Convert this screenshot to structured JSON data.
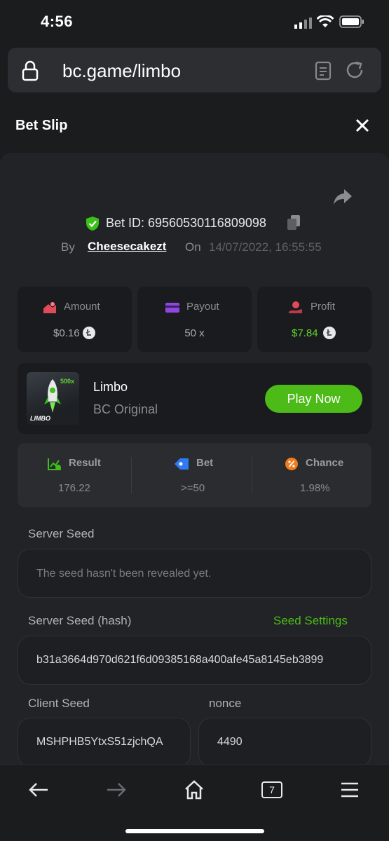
{
  "status_bar": {
    "time": "4:56"
  },
  "browser": {
    "url": "bc.game/limbo",
    "tab_count": "7"
  },
  "header": {
    "title": "Bet Slip"
  },
  "bet": {
    "id_label": "Bet ID: 69560530116809098",
    "by_label": "By",
    "user": "Cheesecakezt",
    "on_label": "On",
    "datetime": "14/07/2022, 16:55:55"
  },
  "stats": {
    "amount_label": "Amount",
    "amount_value": "$0.16",
    "payout_label": "Payout",
    "payout_value": "50 x",
    "profit_label": "Profit",
    "profit_value": "$7.84"
  },
  "game": {
    "thumb_badge": "500x",
    "thumb_logo": "LIMBO",
    "name": "Limbo",
    "provider": "BC Original",
    "play_label": "Play Now"
  },
  "result": {
    "result_label": "Result",
    "result_value": "176.22",
    "bet_label": "Bet",
    "bet_value": ">=50",
    "chance_label": "Chance",
    "chance_value": "1.98%"
  },
  "seeds": {
    "server_seed_label": "Server Seed",
    "server_seed_value": "The seed hasn't been revealed yet.",
    "server_hash_label": "Server Seed (hash)",
    "seed_settings_label": "Seed Settings",
    "server_hash_value": "b31a3664d970d621f6d09385168a400afe45a8145eb3899",
    "client_seed_label": "Client Seed",
    "client_seed_value": "MSHPHB5YtxS51zjchQA",
    "nonce_label": "nonce",
    "nonce_value": "4490"
  },
  "colors": {
    "accent_green": "#4cbb17",
    "profit_green": "#5dd62c",
    "background": "#1b1c1e"
  }
}
